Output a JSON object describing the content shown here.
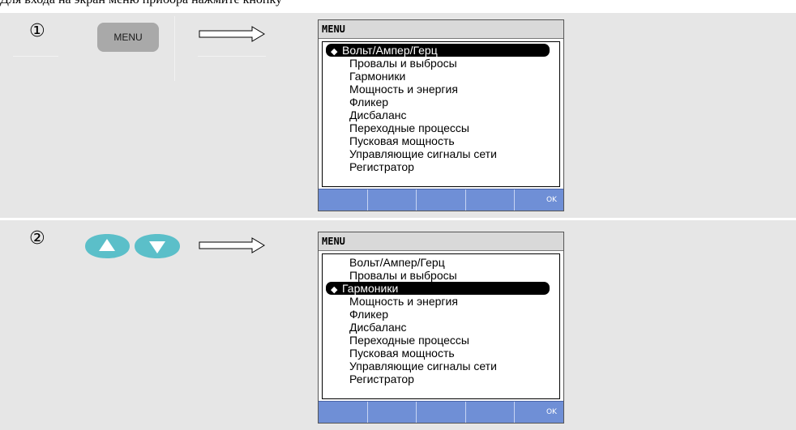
{
  "header_cutoff_text": "Для входа на экран меню прибора нажмите кнопку",
  "colors": {
    "row_bg": "#e6e6e6",
    "key_gray": "#a9a9a9",
    "key_blue": "#5bbfc9",
    "softkey_blue": "#6f8fd6"
  },
  "steps": [
    {
      "number": "①",
      "key_label": "MENU",
      "screen": {
        "title": "MENU",
        "selected_index": 0,
        "items": [
          "Вольт/Ампер/Герц",
          "Провалы и выбросы",
          "Гармоники",
          "Мощность и энергия",
          "Фликер",
          "Дисбаланс",
          "Переходные процессы",
          "Пусковая мощность",
          "Управляющие сигналы сети",
          "Регистратор"
        ],
        "softkeys": [
          "",
          "",
          "",
          "",
          "OK"
        ]
      }
    },
    {
      "number": "②",
      "keys": [
        "arrow-up-icon",
        "arrow-down-icon"
      ],
      "screen": {
        "title": "MENU",
        "selected_index": 2,
        "items": [
          "Вольт/Ампер/Герц",
          "Провалы и выбросы",
          "Гармоники",
          "Мощность и энергия",
          "Фликер",
          "Дисбаланс",
          "Переходные процессы",
          "Пусковая мощность",
          "Управляющие сигналы сети",
          "Регистратор"
        ],
        "softkeys": [
          "",
          "",
          "",
          "",
          "OK"
        ]
      }
    }
  ]
}
